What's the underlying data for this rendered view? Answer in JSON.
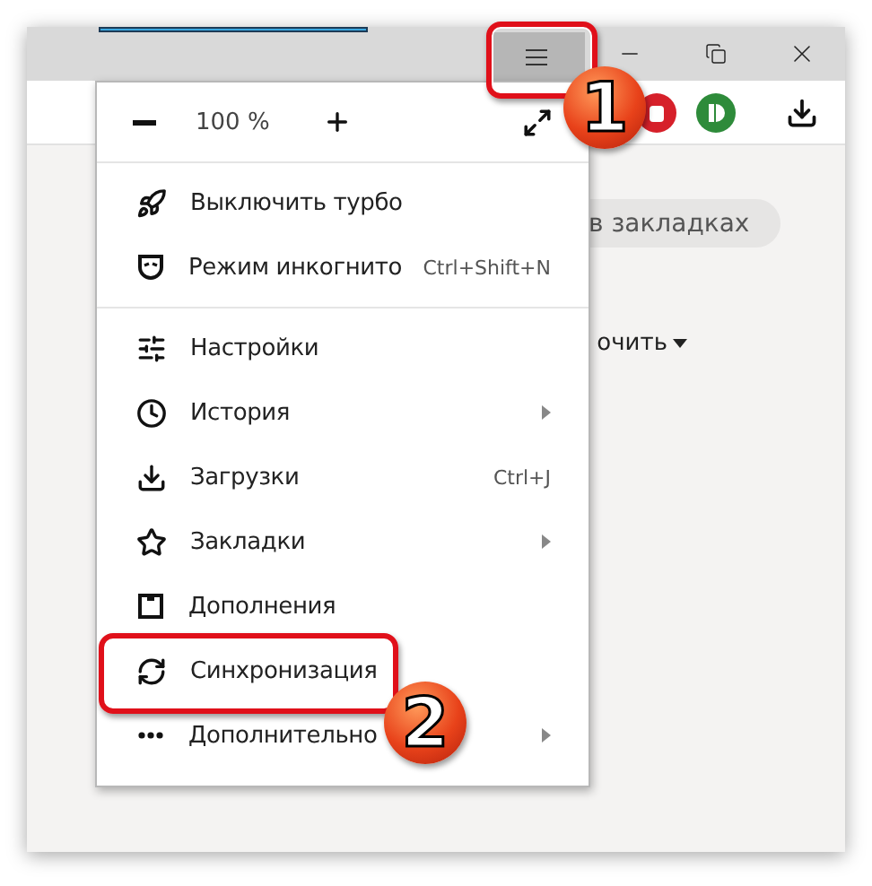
{
  "menu": {
    "zoom": "100 %",
    "sections": [
      [
        {
          "label": "Выключить турбо",
          "submenu": false
        },
        {
          "label": "Режим инкогнито",
          "shortcut": "Ctrl+Shift+N",
          "submenu": false
        }
      ],
      [
        {
          "label": "Настройки",
          "submenu": false
        },
        {
          "label": "История",
          "submenu": true
        },
        {
          "label": "Загрузки",
          "shortcut": "Ctrl+J",
          "submenu": false
        },
        {
          "label": "Закладки",
          "submenu": true
        },
        {
          "label": "Дополнения",
          "submenu": false
        },
        {
          "label": "Синхронизация",
          "submenu": false
        },
        {
          "label": "Дополнительно",
          "submenu": true
        }
      ]
    ]
  },
  "page": {
    "search": {
      "placeholder": "в закладках"
    },
    "sort_label": "очить"
  },
  "callouts": [
    {
      "label": "1"
    },
    {
      "label": "2"
    }
  ]
}
